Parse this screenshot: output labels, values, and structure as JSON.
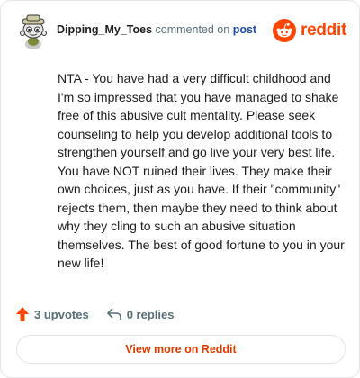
{
  "header": {
    "username": "Dipping_My_Toes",
    "action_text": "commented on",
    "post_link": "post",
    "brand_name": "reddit"
  },
  "comment": {
    "text": "NTA - You have had a very difficult childhood and I'm so impressed that you have managed to shake free of this abusive cult mentality. Please seek counseling to help you develop additional tools to strengthen yourself and go live your very best life. You have NOT ruined their lives. They make their own choices, just as you have. If their \"community\" rejects them, then maybe they need to think about why they cling to such an abusive situation themselves. The best of good fortune to you in your new life!"
  },
  "footer": {
    "upvotes": "3 upvotes",
    "replies": "0 replies"
  },
  "view_more_label": "View more on Reddit",
  "colors": {
    "brand": "#ff4500",
    "link": "#1c4a9c",
    "muted": "#576f76",
    "cta": "#d93a00"
  },
  "icons": {
    "avatar": "snoo-avatar-icon",
    "brand": "reddit-logo-icon",
    "upvote": "upvote-arrow-icon",
    "reply": "reply-arrow-icon"
  }
}
